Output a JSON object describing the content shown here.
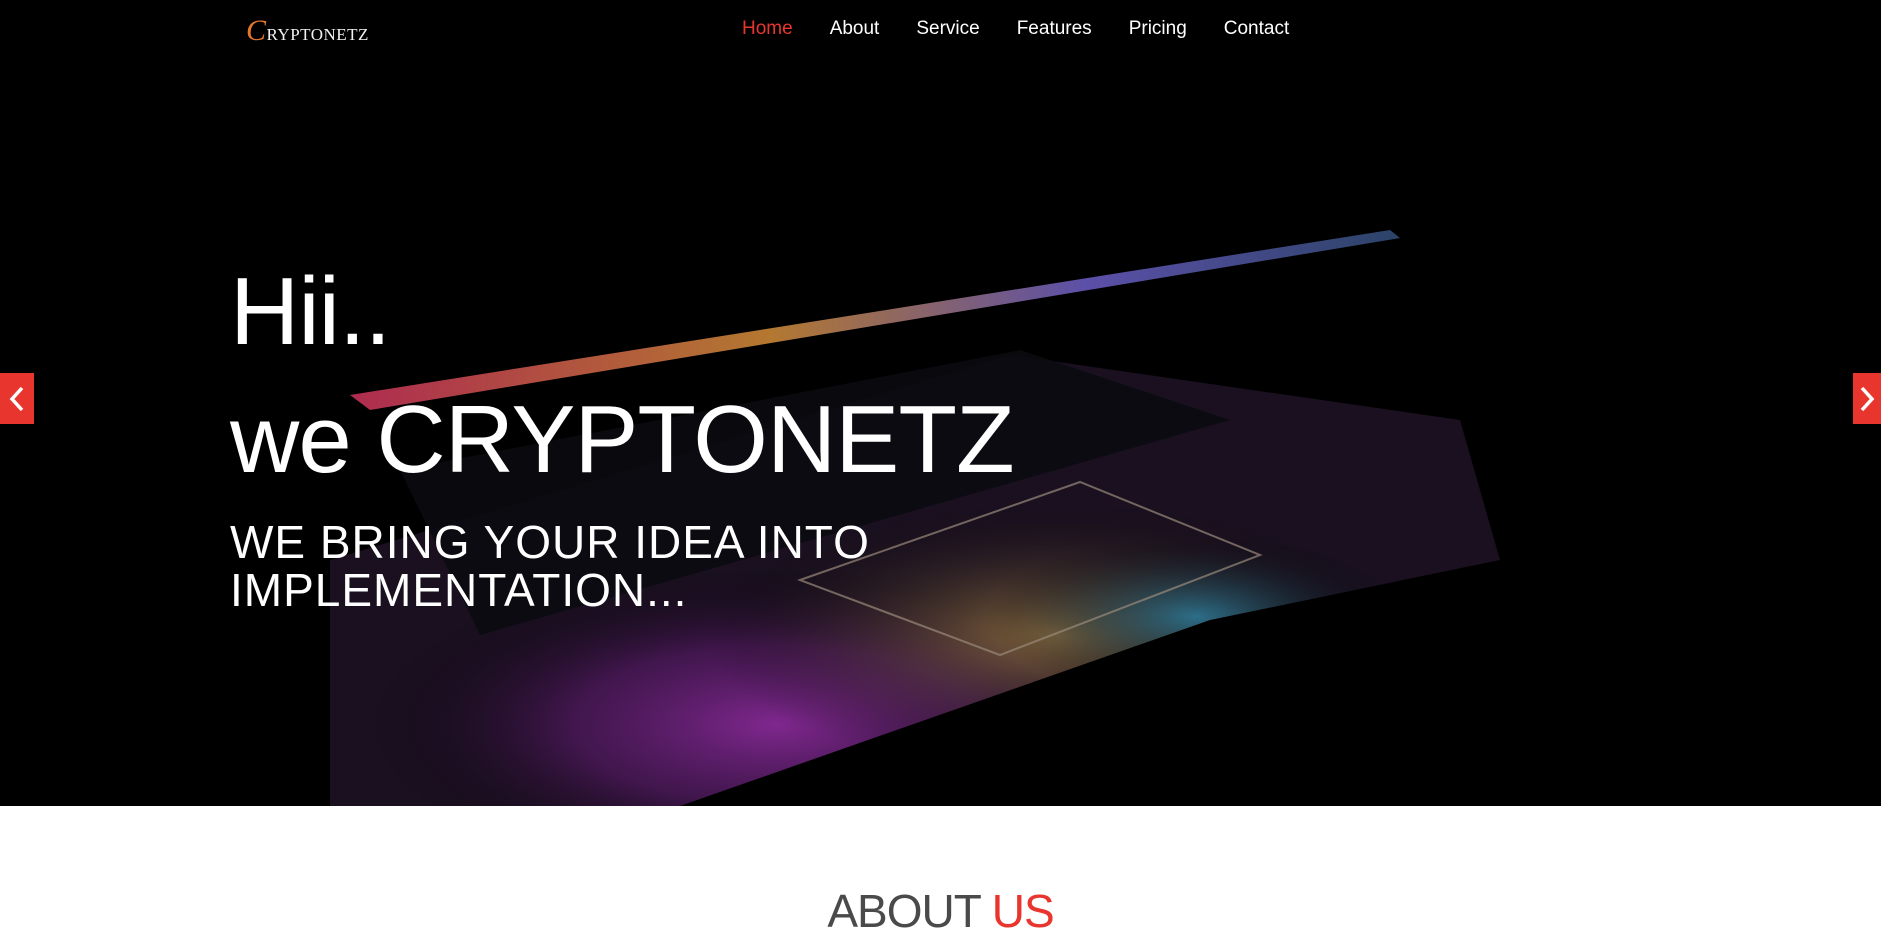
{
  "brand": {
    "logo_initial": "C",
    "logo_rest": "ryptonetz"
  },
  "nav": {
    "items": [
      {
        "label": "Home",
        "active": true
      },
      {
        "label": "About",
        "active": false
      },
      {
        "label": "Service",
        "active": false
      },
      {
        "label": "Features",
        "active": false
      },
      {
        "label": "Pricing",
        "active": false
      },
      {
        "label": "Contact",
        "active": false
      }
    ]
  },
  "hero": {
    "greeting": "Hii..",
    "headline": "we CRYPTONETZ",
    "tagline": "WE BRING YOUR IDEA INTO IMPLEMENTATION..."
  },
  "slider": {
    "prev_icon": "chevron-left-icon",
    "next_icon": "chevron-right-icon"
  },
  "about": {
    "title_part1": "ABOUT",
    "title_part2": "US"
  },
  "colors": {
    "accent": "#e8362f",
    "logo_orange": "#e8772a",
    "hero_bg": "#000000"
  }
}
